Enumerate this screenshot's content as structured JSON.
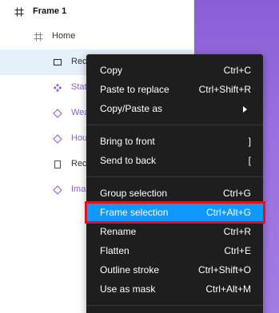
{
  "layers": {
    "frame": {
      "label": "Frame 1",
      "icon": "frame-icon"
    },
    "home": {
      "label": "Home",
      "icon": "frame-icon"
    },
    "children": [
      {
        "label": "Rec",
        "icon": "rectangle-icon",
        "selected": true
      },
      {
        "label": "Stat",
        "icon": "component-instance-icon",
        "purple": true
      },
      {
        "label": "Wea",
        "icon": "component-diamond-icon",
        "purple": true
      },
      {
        "label": "Hou",
        "icon": "component-diamond-icon",
        "purple": true
      },
      {
        "label": "Rec",
        "icon": "rectangle-icon"
      },
      {
        "label": "Ima",
        "icon": "component-diamond-icon",
        "purple": true
      }
    ]
  },
  "context_menu": {
    "groups": [
      [
        {
          "label": "Copy",
          "shortcut": "Ctrl+C"
        },
        {
          "label": "Paste to replace",
          "shortcut": "Ctrl+Shift+R"
        },
        {
          "label": "Copy/Paste as",
          "submenu": true
        }
      ],
      [
        {
          "label": "Bring to front",
          "shortcut": "]"
        },
        {
          "label": "Send to back",
          "shortcut": "["
        }
      ],
      [
        {
          "label": "Group selection",
          "shortcut": "Ctrl+G"
        },
        {
          "label": "Frame selection",
          "shortcut": "Ctrl+Alt+G",
          "highlighted": true
        },
        {
          "label": "Rename",
          "shortcut": "Ctrl+R"
        },
        {
          "label": "Flatten",
          "shortcut": "Ctrl+E"
        },
        {
          "label": "Outline stroke",
          "shortcut": "Ctrl+Shift+O"
        },
        {
          "label": "Use as mask",
          "shortcut": "Ctrl+Alt+M"
        }
      ]
    ]
  },
  "colors": {
    "menu_bg": "#1e1e1e",
    "highlight": "#0d99ff",
    "annotation_box": "#e0121a",
    "component_purple": "#8d62da",
    "selection_bg": "#e6f0fb"
  }
}
